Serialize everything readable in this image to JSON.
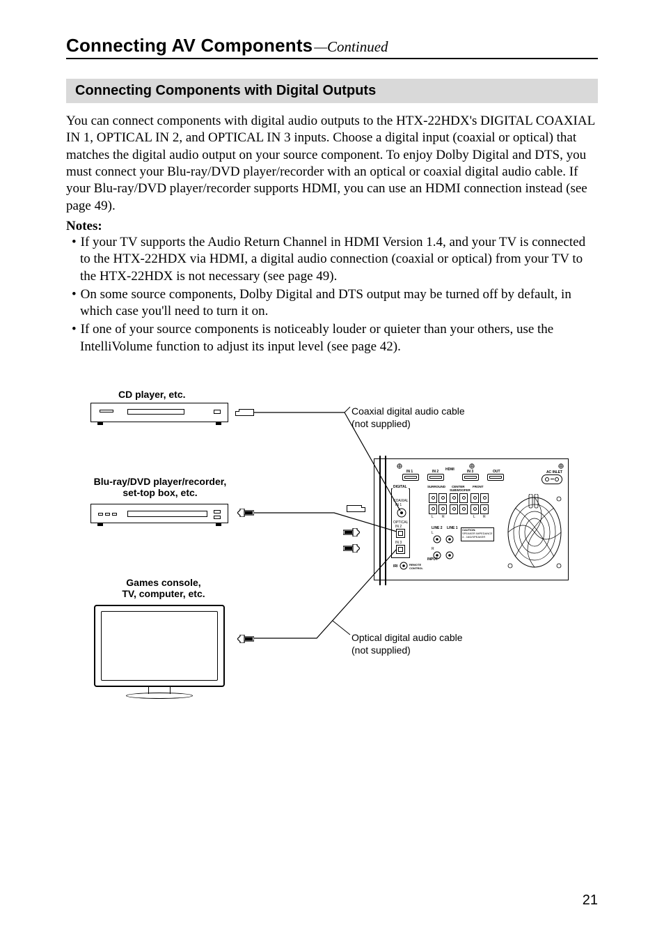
{
  "header": {
    "chapter": "Connecting AV Components",
    "continued": "—Continued"
  },
  "section": {
    "title": "Connecting Components with Digital Outputs"
  },
  "paragraph": "You can connect components with digital audio outputs to the HTX-22HDX's DIGITAL COAXIAL IN 1, OPTICAL IN 2, and OPTICAL IN 3 inputs. Choose a digital input (coaxial or optical) that matches the digital audio output on your source component. To enjoy Dolby Digital and DTS, you must connect your Blu-ray/DVD player/recorder with an optical or coaxial digital audio cable. If your Blu-ray/DVD player/recorder supports HDMI, you can use an HDMI connection instead (see page 49).",
  "notes_label": "Notes:",
  "notes": [
    "If your TV supports the Audio Return Channel in HDMI Version 1.4, and your TV is connected to the HTX-22HDX via HDMI, a digital audio connection (coaxial or optical) from your TV to the HTX-22HDX is not necessary (see page 49).",
    "On some source components, Dolby Digital and DTS output may be turned off by default, in which case you'll need to turn it on.",
    "If one of your source components is noticeably louder or quieter than your others, use the IntelliVolume function to adjust its input level (see page 42)."
  ],
  "diagram": {
    "cd_label": "CD player, etc.",
    "bluray_label_1": "Blu-ray/DVD player/recorder,",
    "bluray_label_2": "set-top box, etc.",
    "games_label_1": "Games console,",
    "games_label_2": "TV, computer, etc.",
    "coax_label_1": "Coaxial digital audio cable",
    "coax_label_2": "(not supplied)",
    "opt_label_1": "Optical digital audio cable",
    "opt_label_2": "(not supplied)",
    "panel": {
      "ac_inlet": "AC INLET",
      "hdmi": "HDMI",
      "in1": "IN 1",
      "in2": "IN 2",
      "in3": "IN 3",
      "out": "OUT",
      "digital": "DIGITAL",
      "coaxial": "COAXIAL",
      "optical": "OPTICAL",
      "surround": "SURROUND",
      "center": "CENTER",
      "front": "FRONT",
      "subwoofer": "SUBWOOFER",
      "line2": "LINE 2",
      "line1": "LINE 1",
      "input": "INPUT",
      "caution": "CAUTION:",
      "impedance": "SPEAKER IMPEDANCE",
      "ohms": "4 - 16Ω/SPEAKER",
      "iri": "IRI",
      "remote_control": "REMOTE CONTROL",
      "l": "L",
      "r": "R"
    }
  },
  "page_number": "21"
}
